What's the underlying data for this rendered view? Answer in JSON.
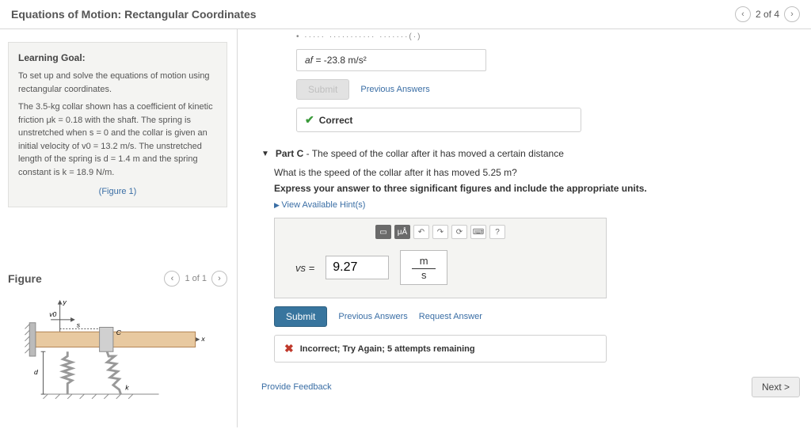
{
  "header": {
    "title": "Equations of Motion: Rectangular Coordinates",
    "page_pos": "2 of 4"
  },
  "learning": {
    "heading": "Learning Goal:",
    "intro": "To set up and solve the equations of motion using rectangular coordinates.",
    "body": "The 3.5-kg collar shown has a coefficient of kinetic friction μk = 0.18 with the shaft. The spring is unstretched when s = 0 and the collar is given an initial velocity of v0 = 13.2 m/s. The unstretched length of the spring is d = 1.4 m and the spring constant is k = 18.9 N/m.",
    "figure_link": "(Figure 1)"
  },
  "figure": {
    "heading": "Figure",
    "pager": "1 of 1",
    "labels": {
      "y": "y",
      "x": "x",
      "v0": "v0",
      "s": "s",
      "C": "C",
      "d": "d",
      "k": "k"
    }
  },
  "partB": {
    "jitter_label": "View Available Hint(s)",
    "answer_prefix": "af =",
    "answer_value": "-23.8",
    "answer_units": "m/s²",
    "submit_label": "Submit",
    "prev_answers": "Previous Answers",
    "correct_label": "Correct"
  },
  "partC": {
    "title_label": "Part C",
    "title_rest": " - The speed of the collar after it has moved a certain distance",
    "q1": "What is the speed of the collar after it has moved 5.25 m?",
    "q2": "Express your answer to three significant figures and include the appropriate units.",
    "hints": "View Available Hint(s)",
    "toolbar_units": "μÅ",
    "eq_label": "vs =",
    "eq_value": "9.27",
    "unit_top": "m",
    "unit_bottom": "s",
    "submit": "Submit",
    "prev_answers": "Previous Answers",
    "request_answer": "Request Answer",
    "feedback": "Incorrect; Try Again; 5 attempts remaining"
  },
  "footer": {
    "provide_feedback": "Provide Feedback",
    "next": "Next >"
  }
}
